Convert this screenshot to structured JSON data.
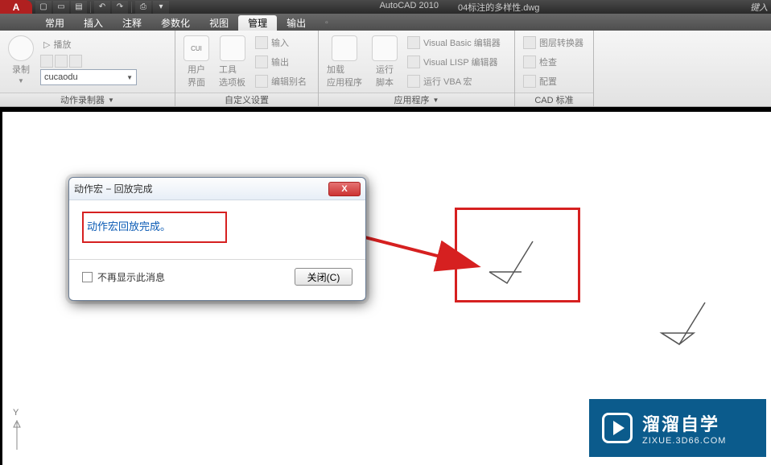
{
  "title_bar": {
    "app_name": "AutoCAD 2010",
    "file_name": "04标注的多样性.dwg",
    "search_hint": "键入"
  },
  "tabs": [
    "常用",
    "插入",
    "注释",
    "参数化",
    "视图",
    "管理",
    "输出"
  ],
  "active_tab_index": 5,
  "ribbon": {
    "panel_recorder": {
      "title": "动作录制器",
      "record": "录制",
      "play": "播放",
      "macro": "cucaodu"
    },
    "panel_custom": {
      "title": "自定义设置",
      "user_interface": "用户\n界面",
      "tool_palettes": "工具\n选项板",
      "import": "输入",
      "export": "输出",
      "edit_alias": "编辑别名"
    },
    "panel_apps": {
      "title": "应用程序",
      "load_app": "加载\n应用程序",
      "run_script": "运行\n脚本",
      "vb_editor": "Visual Basic 编辑器",
      "vlisp_editor": "Visual LISP 编辑器",
      "run_vba": "运行 VBA 宏"
    },
    "panel_standards": {
      "title": "CAD 标准",
      "layer_translator": "图层转换器",
      "check": "检查",
      "configure": "配置"
    }
  },
  "dialog": {
    "title": "动作宏 − 回放完成",
    "message": "动作宏回放完成。",
    "dont_show": "不再显示此消息",
    "close": "关闭(C)",
    "close_x": "X"
  },
  "watermark": {
    "main": "溜溜自学",
    "sub": "ZIXUE.3D66.COM"
  },
  "ucs_label": "Y"
}
